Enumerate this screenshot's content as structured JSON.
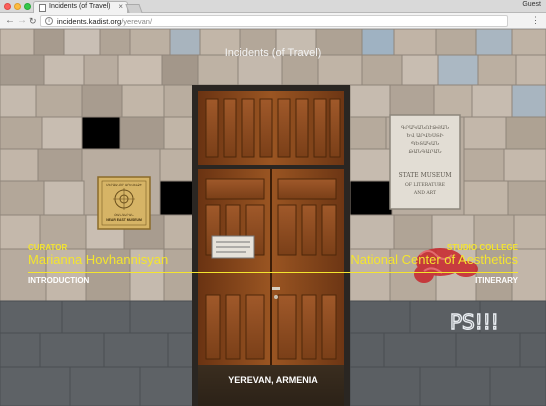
{
  "browser": {
    "tab_title": "Incidents (of Travel)",
    "tab_close": "×",
    "profile": "Guest",
    "url_host": "incidents.kadist.org",
    "url_path": "/yerevan/",
    "back_icon": "arrow-left-icon",
    "forward_icon": "arrow-right-icon",
    "reload_icon": "reload-icon",
    "info_icon": "info-icon",
    "menu_icon": "menu-icon"
  },
  "page": {
    "title": "Incidents (of Travel)",
    "curator_label": "CURATOR",
    "curator_name": "Marianna Hovhannisyan",
    "introduction_link": "INTRODUCTION",
    "studio_label": "STUDIO COLLEGE",
    "center_name": "National Center of Aesthetics",
    "itinerary_link": "ITINERARY",
    "place": "YEREVAN, ARMENIA"
  },
  "photo": {
    "left_plaque_lines": [
      "ՄԵՐՁԱՎՈՐ ԱՐԵՎԵԼՔԻ",
      "ԹԱՆԳԱՐԱՆ",
      "NEAR EAST MUSEUM"
    ],
    "right_plaque_lines": [
      "ԳՐԱԿԱՆՈՒԹՅԱՆ",
      "ԵՎ ԱՐՎԵՍՏԻ",
      "ՊԵՏԱԿԱՆ",
      "ԹԱՆԳԱՐԱՆ",
      "STATE MUSEUM",
      "OF LITERATURE",
      "AND ART"
    ],
    "graffiti": "PS!!!"
  },
  "colors": {
    "accent_yellow": "#f4e52e",
    "door_wood": "#8a4a1c",
    "graffiti_red": "#c8262c"
  }
}
